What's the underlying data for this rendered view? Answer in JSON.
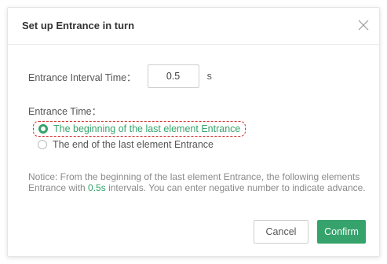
{
  "dialog": {
    "title": "Set up Entrance in turn",
    "close_icon": "close-icon"
  },
  "interval": {
    "label": "Entrance Interval Time：",
    "value": "0.5",
    "unit": "s"
  },
  "entrance_time": {
    "label": "Entrance Time：",
    "options": [
      {
        "label": "The beginning of the last element Entrance",
        "selected": true
      },
      {
        "label": "The end of the last element Entrance",
        "selected": false
      }
    ]
  },
  "notice": {
    "before": "Notice: From the beginning of the last element Entrance, the following elements Entrance with ",
    "value": "0.5s",
    "after": " intervals. You can enter negative number to indicate advance."
  },
  "buttons": {
    "cancel": "Cancel",
    "confirm": "Confirm"
  },
  "colors": {
    "accent": "#35a36b",
    "highlight_border": "#d32f2f"
  }
}
